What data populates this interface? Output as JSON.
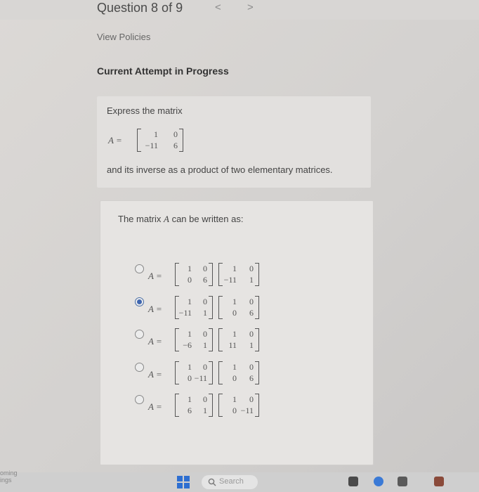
{
  "header": {
    "question": "Question 8 of 9",
    "prev": "<",
    "next": ">"
  },
  "policies_link": "View Policies",
  "attempt_title": "Current Attempt in Progress",
  "question": {
    "intro": "Express the matrix",
    "matrix_label": "A =",
    "matrix": [
      [
        "1",
        "0"
      ],
      [
        "−11",
        "6"
      ]
    ],
    "outro": "and its inverse as a product of two elementary matrices."
  },
  "answer": {
    "prompt_before": "The matrix ",
    "prompt_var": "A",
    "prompt_after": " can be written as:",
    "label": "A =",
    "selected_index": 1,
    "options": [
      {
        "m1": [
          [
            "1",
            "0"
          ],
          [
            "0",
            "6"
          ]
        ],
        "m2": [
          [
            "1",
            "0"
          ],
          [
            "−11",
            "1"
          ]
        ]
      },
      {
        "m1": [
          [
            "1",
            "0"
          ],
          [
            "−11",
            "1"
          ]
        ],
        "m2": [
          [
            "1",
            "0"
          ],
          [
            "0",
            "6"
          ]
        ]
      },
      {
        "m1": [
          [
            "1",
            "0"
          ],
          [
            "−6",
            "1"
          ]
        ],
        "m2": [
          [
            "1",
            "0"
          ],
          [
            "11",
            "1"
          ]
        ]
      },
      {
        "m1": [
          [
            "1",
            "0"
          ],
          [
            "0",
            "−11"
          ]
        ],
        "m2": [
          [
            "1",
            "0"
          ],
          [
            "0",
            "6"
          ]
        ]
      },
      {
        "m1": [
          [
            "1",
            "0"
          ],
          [
            "6",
            "1"
          ]
        ],
        "m2": [
          [
            "1",
            "0"
          ],
          [
            "0",
            "−11"
          ]
        ]
      }
    ]
  },
  "taskbar": {
    "search": "Search",
    "corner_line1": "oming",
    "corner_line2": "ings"
  },
  "colors": {
    "accent": "#3f66b0",
    "win_logo": "#2e6fd1"
  }
}
